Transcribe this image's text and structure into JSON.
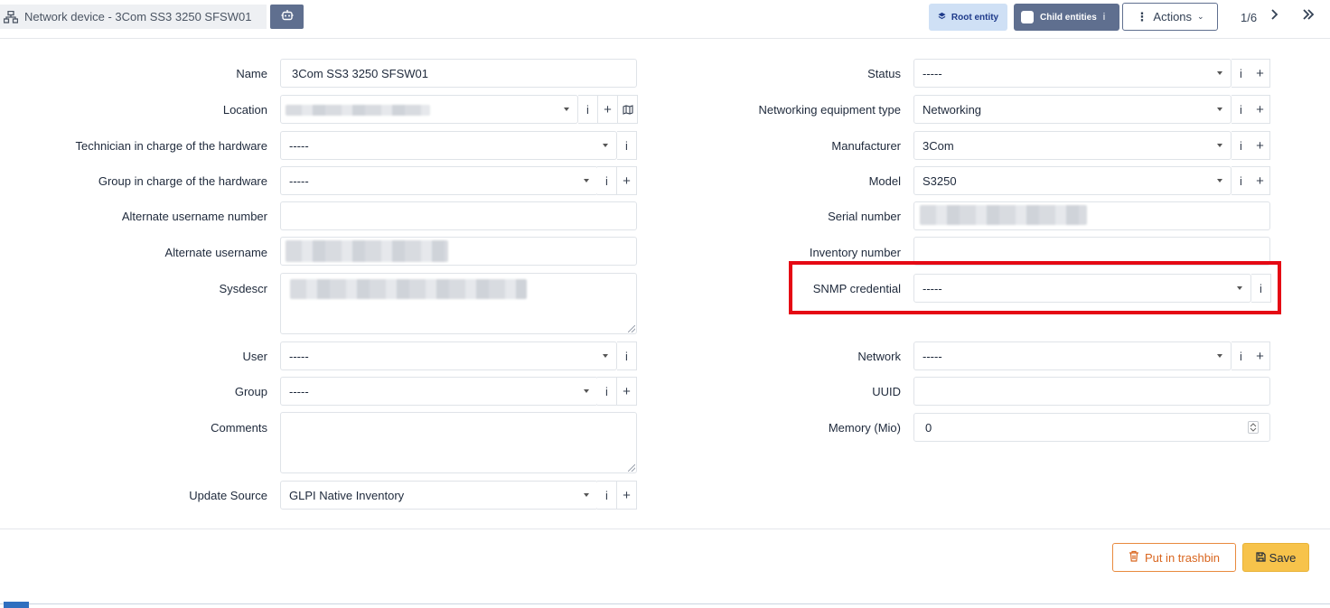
{
  "header": {
    "title": "Network device - 3Com SS3 3250 SFSW01",
    "root_entity": "Root entity",
    "child_entities": "Child entities",
    "actions": "Actions",
    "pager": "1/6"
  },
  "form": {
    "left": {
      "name_label": "Name",
      "name_value": "3Com SS3 3250 SFSW01",
      "location_label": "Location",
      "technician_label": "Technician in charge of the hardware",
      "technician_value": "-----",
      "group_hw_label": "Group in charge of the hardware",
      "group_hw_value": "-----",
      "alt_username_number_label": "Alternate username number",
      "alt_username_label": "Alternate username",
      "sysdescr_label": "Sysdescr",
      "user_label": "User",
      "user_value": "-----",
      "group_label": "Group",
      "group_value": "-----",
      "comments_label": "Comments",
      "update_source_label": "Update Source",
      "update_source_value": "GLPI Native Inventory"
    },
    "right": {
      "status_label": "Status",
      "status_value": "-----",
      "type_label": "Networking equipment type",
      "type_value": "Networking",
      "manufacturer_label": "Manufacturer",
      "manufacturer_value": "3Com",
      "model_label": "Model",
      "model_value": "S3250",
      "serial_label": "Serial number",
      "inventory_label": "Inventory number",
      "snmp_label": "SNMP credential",
      "snmp_value": "-----",
      "network_label": "Network",
      "network_value": "-----",
      "uuid_label": "UUID",
      "memory_label": "Memory (Mio)",
      "memory_value": "0"
    }
  },
  "footer": {
    "trash": "Put in trashbin",
    "save": "Save"
  },
  "colors": {
    "highlight": "#e50914",
    "save": "#f7c34b",
    "trash": "#d9661f",
    "root_entity_bg": "#cfe0f5",
    "slate": "#5f6f8f"
  }
}
